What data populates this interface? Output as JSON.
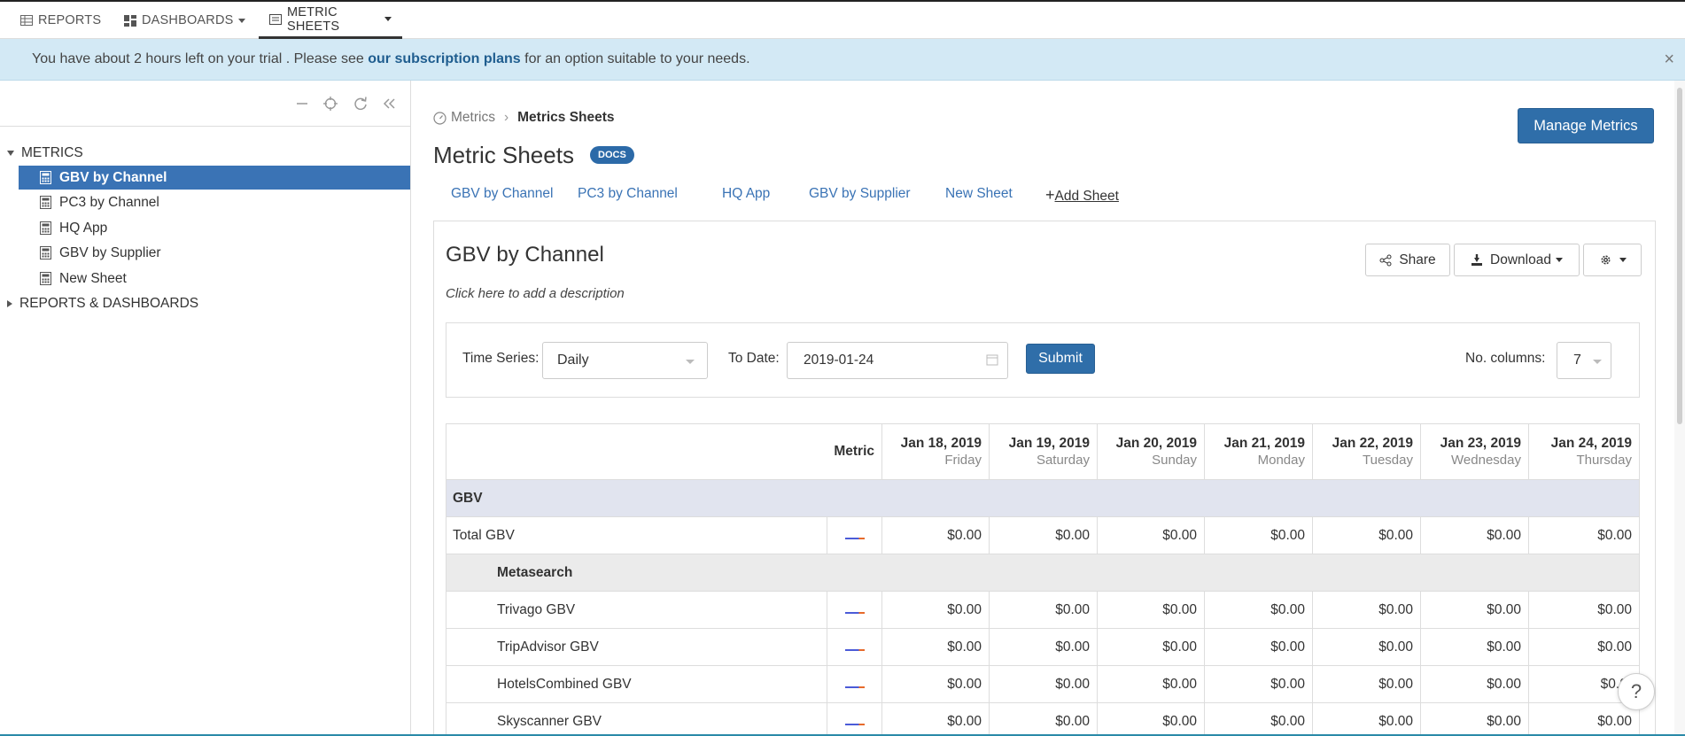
{
  "topnav": {
    "items": [
      {
        "label": "REPORTS",
        "icon": "table-icon"
      },
      {
        "label": "DASHBOARDS",
        "icon": "dashboard-icon"
      },
      {
        "label": "METRIC SHEETS",
        "icon": "sheet-icon"
      }
    ]
  },
  "banner": {
    "text_before": "You have about 2 hours left on your trial . Please see ",
    "link": "our subscription plans",
    "text_after": " for an option suitable to your needs.",
    "close": "×"
  },
  "sidebar": {
    "metrics_header": "METRICS",
    "items": [
      {
        "label": "GBV by Channel"
      },
      {
        "label": "PC3 by Channel"
      },
      {
        "label": "HQ App"
      },
      {
        "label": "GBV by Supplier"
      },
      {
        "label": "New Sheet"
      }
    ],
    "reports_header": "REPORTS & DASHBOARDS"
  },
  "breadcrumb": {
    "root": "Metrics",
    "current": "Metrics Sheets"
  },
  "page": {
    "title": "Metric Sheets",
    "badge": "DOCS",
    "manage_button": "Manage Metrics"
  },
  "tabs": [
    "GBV by Channel",
    "PC3 by Channel",
    "HQ App",
    "GBV by Supplier",
    "New Sheet"
  ],
  "add_sheet": "Add Sheet",
  "sheet": {
    "title": "GBV by Channel",
    "description": "Click here to add a description",
    "share": "Share",
    "download": "Download"
  },
  "filters": {
    "time_series_label": "Time Series:",
    "time_series_value": "Daily",
    "to_date_label": "To Date:",
    "to_date_value": "2019-01-24",
    "submit": "Submit",
    "columns_label": "No. columns:",
    "columns_value": "7"
  },
  "table": {
    "metric_header": "Metric",
    "columns": [
      {
        "date": "Jan 18, 2019",
        "dow": "Friday"
      },
      {
        "date": "Jan 19, 2019",
        "dow": "Saturday"
      },
      {
        "date": "Jan 20, 2019",
        "dow": "Sunday"
      },
      {
        "date": "Jan 21, 2019",
        "dow": "Monday"
      },
      {
        "date": "Jan 22, 2019",
        "dow": "Tuesday"
      },
      {
        "date": "Jan 23, 2019",
        "dow": "Wednesday"
      },
      {
        "date": "Jan 24, 2019",
        "dow": "Thursday"
      }
    ],
    "group": "GBV",
    "total_row": {
      "name": "Total GBV",
      "values": [
        "$0.00",
        "$0.00",
        "$0.00",
        "$0.00",
        "$0.00",
        "$0.00",
        "$0.00"
      ]
    },
    "subgroup": "Metasearch",
    "rows": [
      {
        "name": "Trivago GBV",
        "values": [
          "$0.00",
          "$0.00",
          "$0.00",
          "$0.00",
          "$0.00",
          "$0.00",
          "$0.00"
        ]
      },
      {
        "name": "TripAdvisor GBV",
        "values": [
          "$0.00",
          "$0.00",
          "$0.00",
          "$0.00",
          "$0.00",
          "$0.00",
          "$0.00"
        ]
      },
      {
        "name": "HotelsCombined GBV",
        "values": [
          "$0.00",
          "$0.00",
          "$0.00",
          "$0.00",
          "$0.00",
          "$0.00",
          "$0.0("
        ]
      },
      {
        "name": "Skyscanner GBV",
        "values": [
          "$0.00",
          "$0.00",
          "$0.00",
          "$0.00",
          "$0.00",
          "$0.00",
          "$0.00"
        ]
      }
    ]
  },
  "help": "?",
  "colors": {
    "primary": "#2f6ea9",
    "selected": "#3a73b5",
    "banner_bg": "#d3e9f5",
    "group_bg": "#e1e4ef",
    "subgroup_bg": "#ebebeb"
  }
}
